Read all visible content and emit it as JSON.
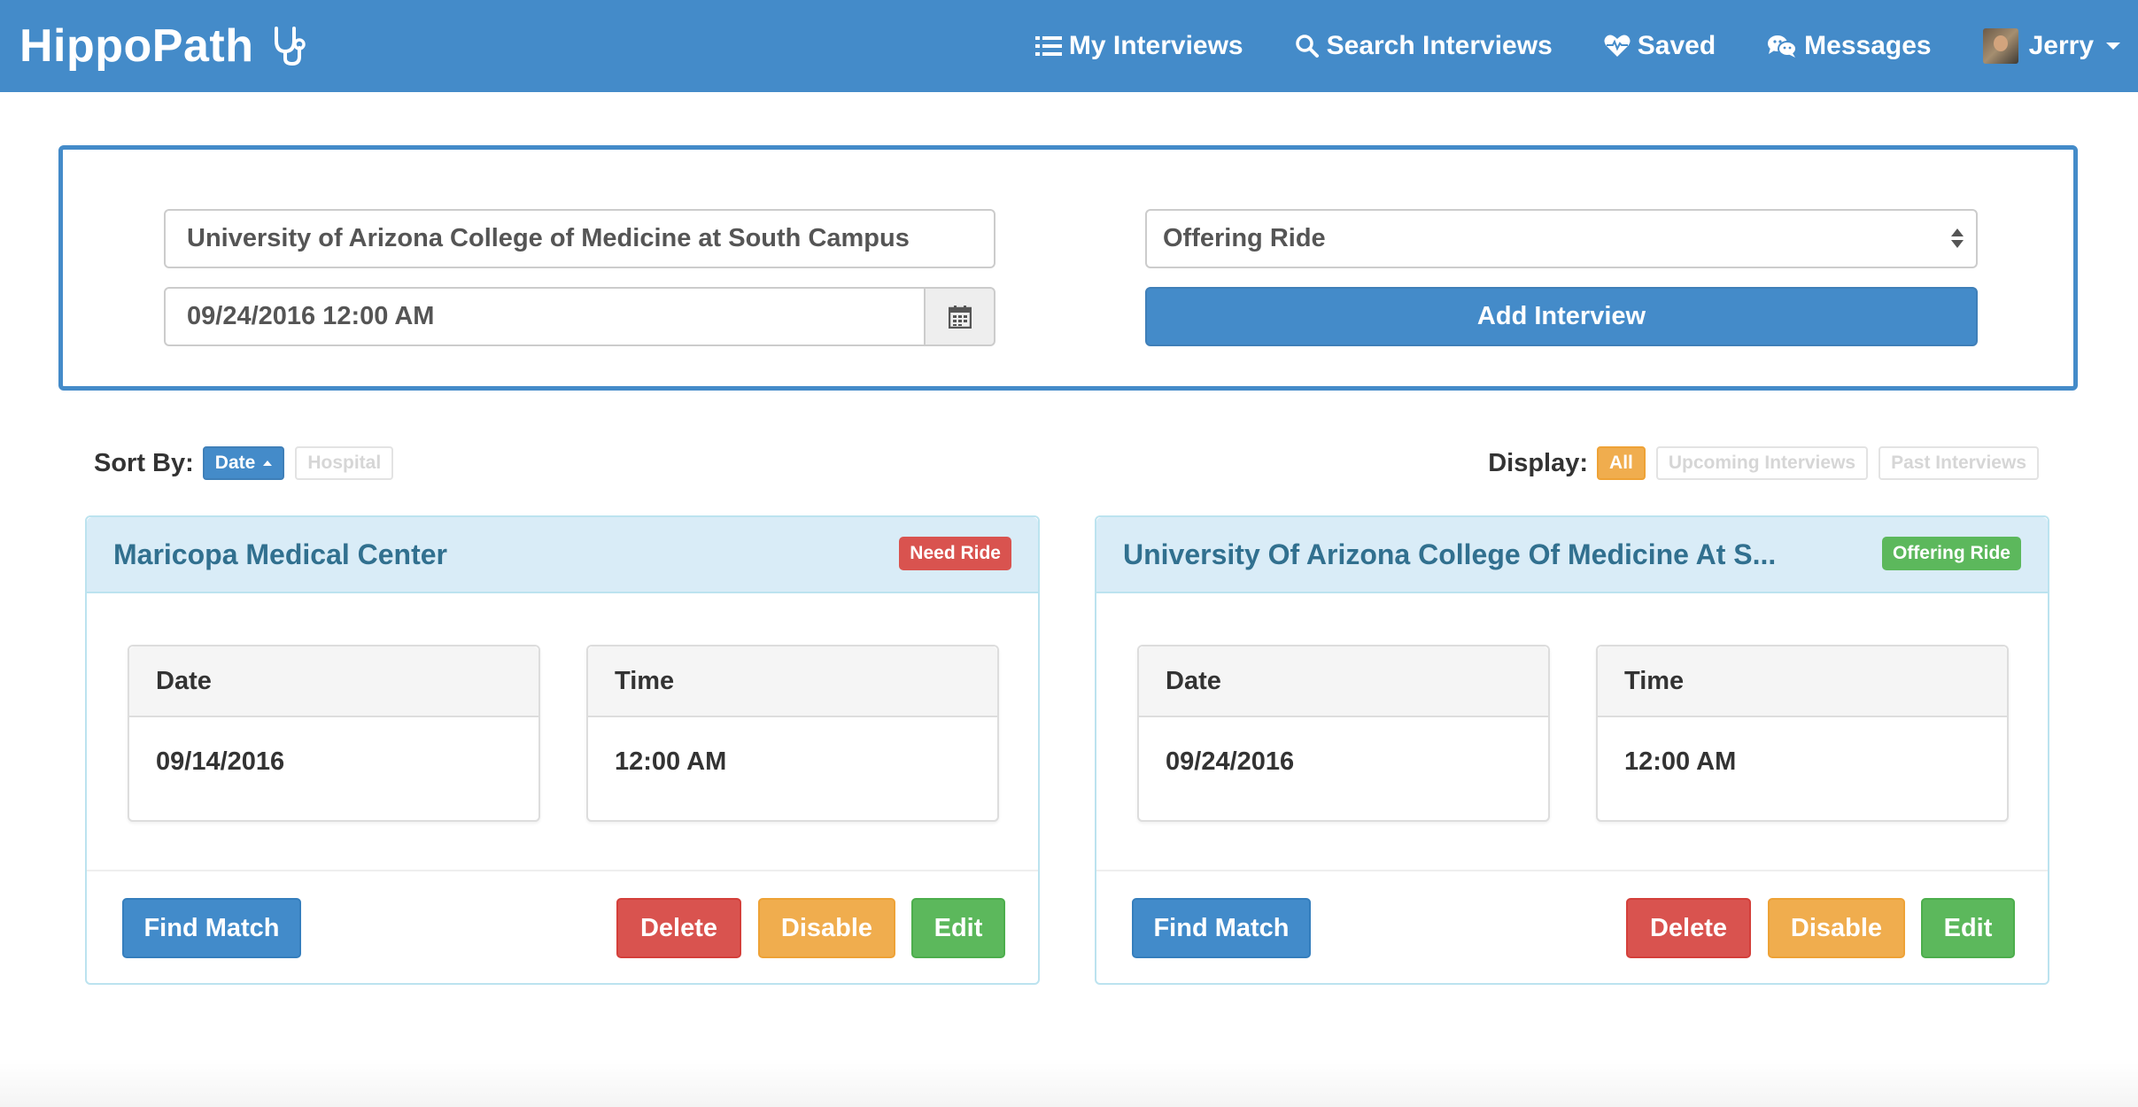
{
  "navbar": {
    "brand": "HippoPath",
    "items": [
      {
        "label": "My Interviews",
        "icon": "list-icon"
      },
      {
        "label": "Search Interviews",
        "icon": "search-icon"
      },
      {
        "label": "Saved",
        "icon": "heartbeat-icon"
      },
      {
        "label": "Messages",
        "icon": "chat-icon"
      }
    ],
    "user": "Jerry"
  },
  "form": {
    "hospital_value": "University of Arizona College of Medicine at South Campus",
    "date_value": "09/24/2016 12:00 AM",
    "ride_selected": "Offering Ride",
    "add_label": "Add Interview"
  },
  "sort": {
    "label": "Sort By:",
    "options": [
      "Date",
      "Hospital"
    ],
    "active": "Date"
  },
  "display": {
    "label": "Display:",
    "options": [
      "All",
      "Upcoming Interviews",
      "Past Interviews"
    ],
    "active": "All"
  },
  "cards": [
    {
      "title": "Maricopa Medical Center",
      "badge": "Need Ride",
      "date_label": "Date",
      "date": "09/14/2016",
      "time_label": "Time",
      "time": "12:00 AM",
      "buttons": {
        "find": "Find Match",
        "delete": "Delete",
        "disable": "Disable",
        "edit": "Edit"
      }
    },
    {
      "title": "University Of Arizona College Of Medicine At S...",
      "badge": "Offering Ride",
      "date_label": "Date",
      "date": "09/24/2016",
      "time_label": "Time",
      "time": "12:00 AM",
      "buttons": {
        "find": "Find Match",
        "delete": "Delete",
        "disable": "Disable",
        "edit": "Edit"
      }
    }
  ],
  "colors": {
    "primary": "#448bc9",
    "danger": "#d9534f",
    "warning": "#f0ad4e",
    "success": "#5cb85c",
    "card_title": "#31708f"
  }
}
